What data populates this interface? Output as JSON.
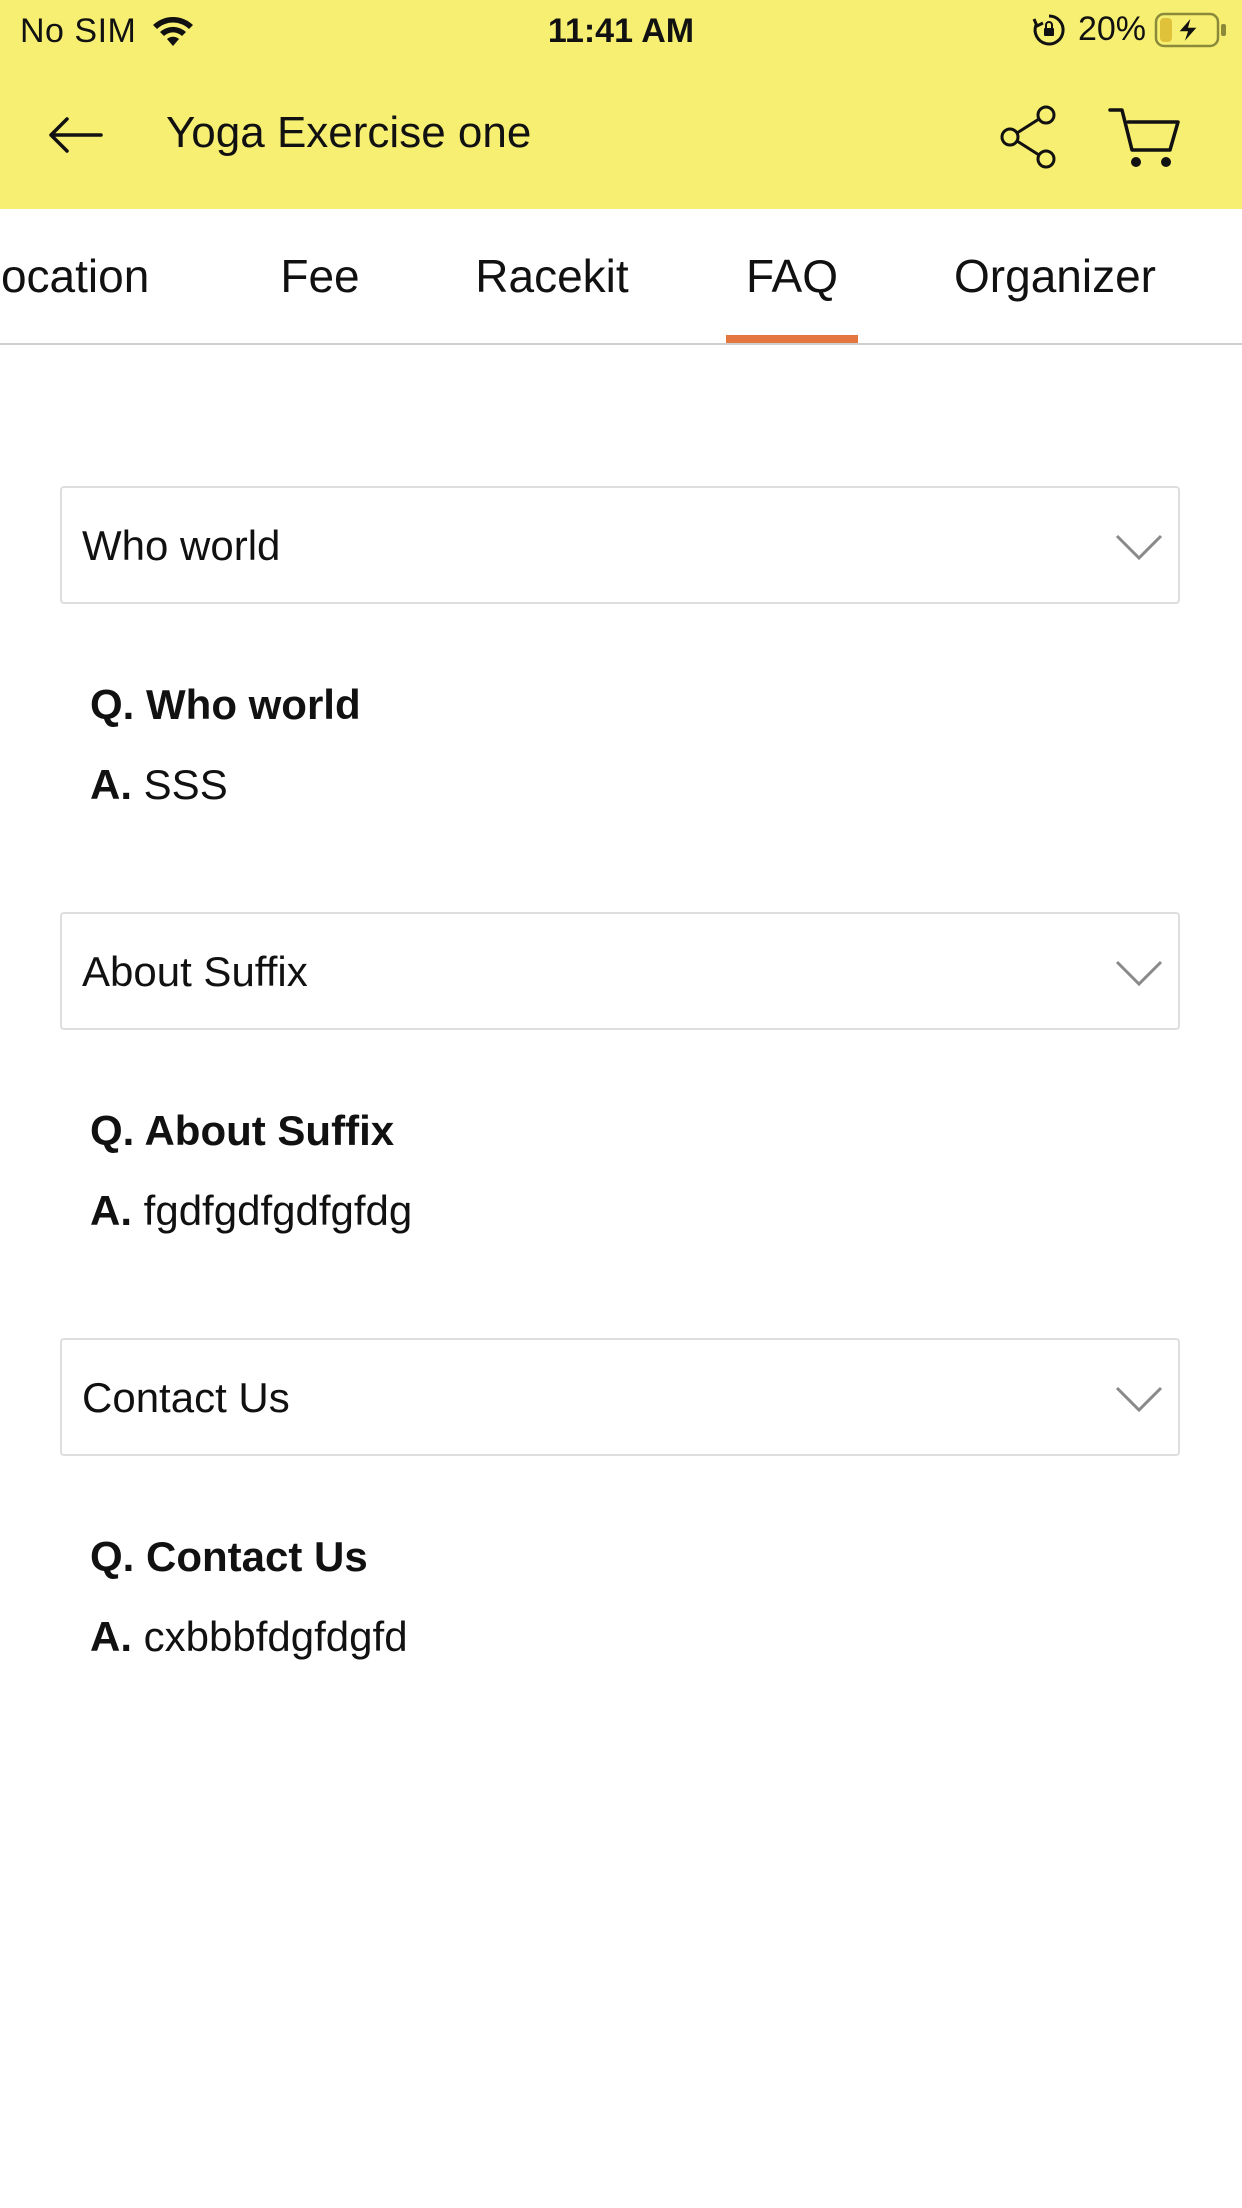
{
  "status_bar": {
    "carrier": "No SIM",
    "time": "11:41 AM",
    "battery": "20%"
  },
  "nav": {
    "title": "Yoga Exercise one",
    "icons": {
      "back": "arrow-left-icon",
      "share": "share-icon",
      "cart": "cart-icon"
    }
  },
  "colors": {
    "header_bg": "#f7ef72",
    "tab_indicator": "#e4763f"
  },
  "tabs": [
    {
      "label": "location",
      "active": false
    },
    {
      "label": "Fee",
      "active": false
    },
    {
      "label": "Racekit",
      "active": false
    },
    {
      "label": "FAQ",
      "active": true
    },
    {
      "label": "Organizer",
      "active": false
    }
  ],
  "faq": {
    "q_prefix": "Q.",
    "a_prefix": "A.",
    "items": [
      {
        "title": "Who world",
        "question": "Who world",
        "answer": "SSS"
      },
      {
        "title": "About Suffix",
        "question": "About Suffix",
        "answer": "fgdfgdfgdfgfdg"
      },
      {
        "title": "Contact Us",
        "question": "Contact Us",
        "answer": "cxbbbfdgfdgfd"
      }
    ]
  }
}
